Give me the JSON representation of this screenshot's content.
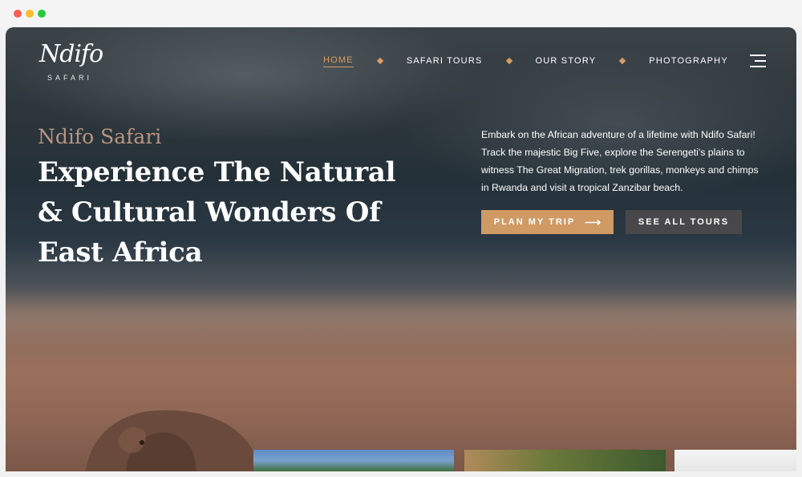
{
  "brand": {
    "logo_text": "Ndifo",
    "logo_sub": "SAFARI"
  },
  "nav": {
    "items": [
      {
        "label": "HOME",
        "active": true
      },
      {
        "label": "SAFARI TOURS",
        "active": false
      },
      {
        "label": "OUR STORY",
        "active": false
      },
      {
        "label": "PHOTOGRAPHY",
        "active": false
      }
    ],
    "menu_icon": "hamburger-icon"
  },
  "hero": {
    "kicker": "Ndifo Safari",
    "title": "Experience The Natural & Cultural Wonders Of East Africa",
    "description": "Embark on the African adventure of a lifetime with Ndifo Safari! Track the majestic Big Five, explore the Serengeti's plains to witness The Great Migration, trek gorillas, monkeys and chimps in Rwanda and visit a tropical Zanzibar beach.",
    "primary_button": "PLAN MY TRIP",
    "primary_button_icon": "arrow-right-icon",
    "secondary_button": "SEE ALL TOURS"
  },
  "colors": {
    "accent": "#d09a64",
    "secondary_button": "#48484a",
    "kicker": "#b89482"
  }
}
